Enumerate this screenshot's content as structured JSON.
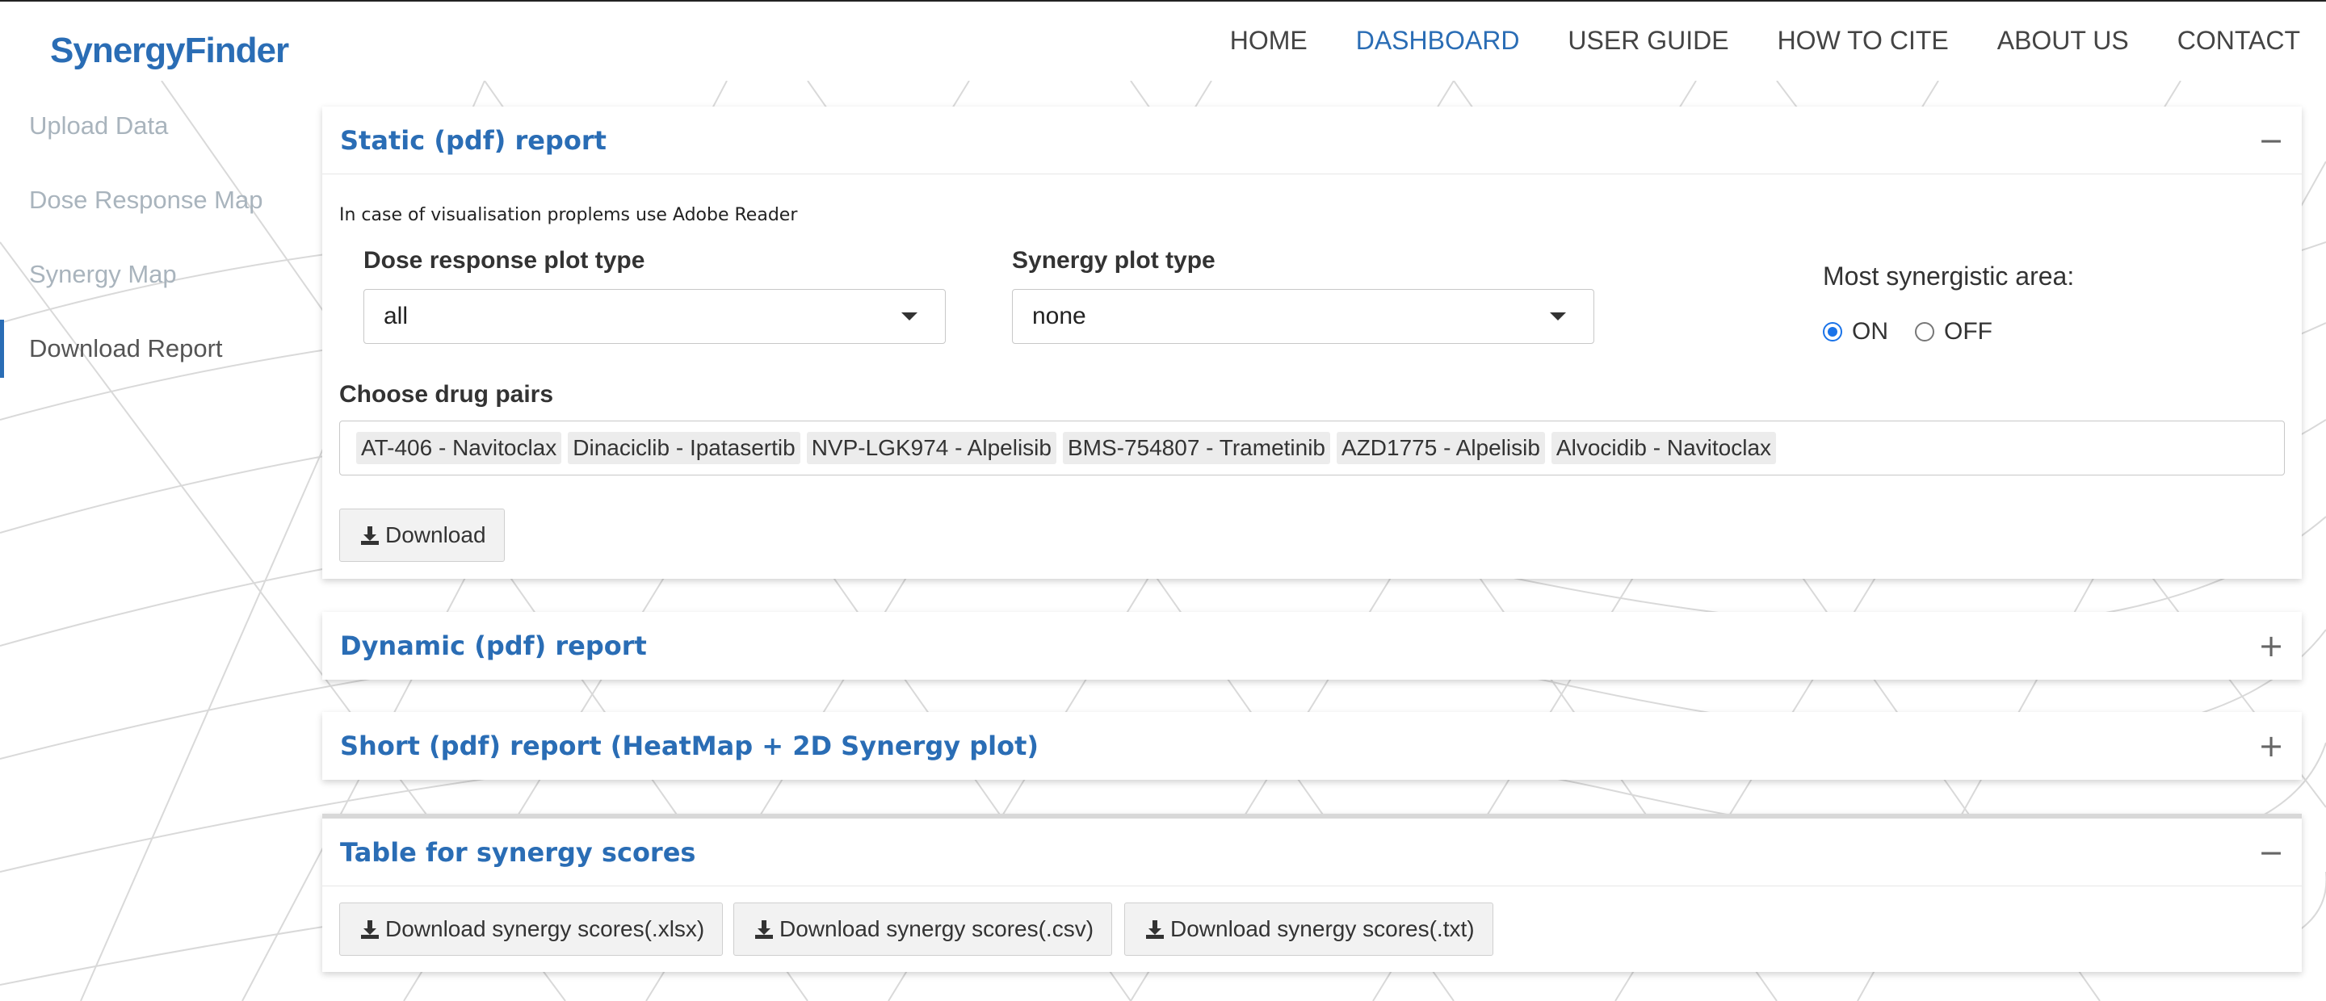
{
  "logo": {
    "text": "SynergyFinder"
  },
  "nav": {
    "items": [
      "HOME",
      "DASHBOARD",
      "USER GUIDE",
      "HOW TO CITE",
      "ABOUT US",
      "CONTACT"
    ],
    "active": "DASHBOARD"
  },
  "sidebar": {
    "items": [
      {
        "label": "Upload Data"
      },
      {
        "label": "Dose Response Map"
      },
      {
        "label": "Synergy Map"
      },
      {
        "label": "Download Report"
      }
    ],
    "active": "Download Report"
  },
  "static_panel": {
    "title": "Static (pdf) report",
    "toggle": "−",
    "note": "In case of visualisation proplems use Adobe Reader",
    "dose_label": "Dose response plot type",
    "dose_value": "all",
    "synergy_label": "Synergy plot type",
    "synergy_value": "none",
    "area_label": "Most synergistic area:",
    "radio_on": "ON",
    "radio_off": "OFF",
    "radio_selected": "ON",
    "pairs_label": "Choose drug pairs",
    "pairs": [
      "AT-406 - Navitoclax",
      "Dinaciclib - Ipatasertib",
      "NVP-LGK974 - Alpelisib",
      "BMS-754807 - Trametinib",
      "AZD1775 - Alpelisib",
      "Alvocidib - Navitoclax"
    ],
    "download_label": "Download"
  },
  "dynamic_panel": {
    "title": "Dynamic (pdf) report",
    "toggle": "+"
  },
  "short_panel": {
    "title": "Short (pdf) report (HeatMap + 2D Synergy plot)",
    "toggle": "+"
  },
  "table_panel": {
    "title": "Table for synergy scores",
    "toggle": "−",
    "buttons": [
      "Download synergy scores(.xlsx)",
      "Download synergy scores(.csv)",
      "Download synergy scores(.txt)"
    ]
  },
  "colors": {
    "accent": "#2a6db5",
    "radio": "#1a73e8"
  },
  "icons": [
    "download-icon",
    "caret-down-icon",
    "collapse-icon",
    "expand-icon"
  ]
}
